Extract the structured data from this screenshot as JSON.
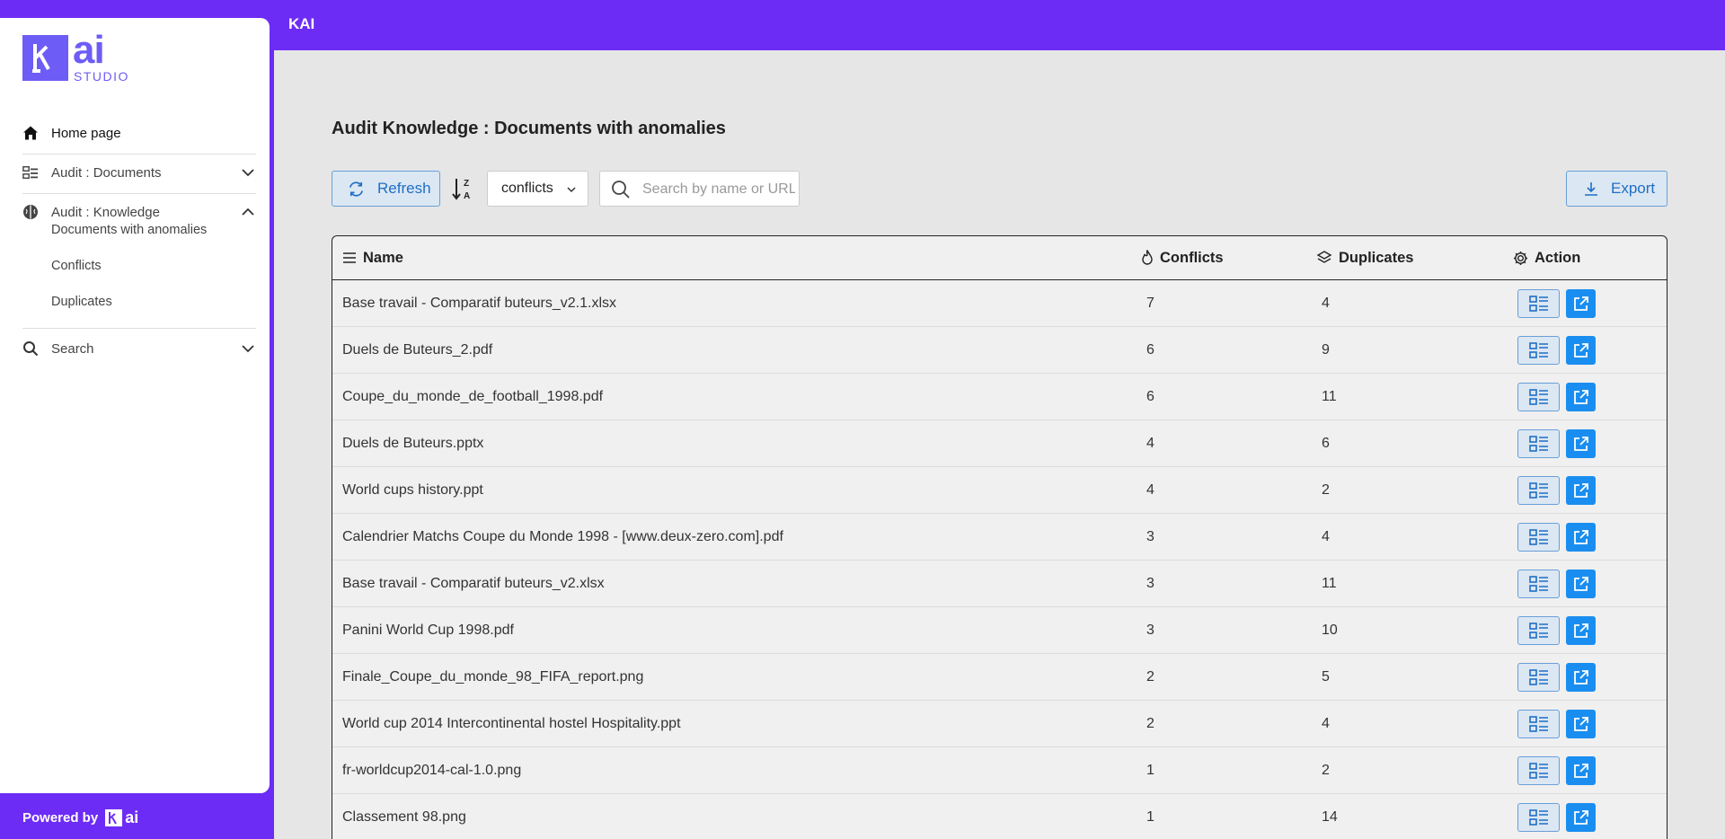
{
  "header": {
    "title": "KAI"
  },
  "logo": {
    "brand": "ai",
    "sub": "STUDIO"
  },
  "sidebar": {
    "items": [
      {
        "label": "Home page"
      },
      {
        "label": "Audit : Documents"
      },
      {
        "label": "Audit : Knowledge"
      },
      {
        "label": "Search"
      }
    ],
    "knowledge_sub": [
      {
        "label": "Documents with anomalies"
      },
      {
        "label": "Conflicts"
      },
      {
        "label": "Duplicates"
      }
    ],
    "footer": {
      "powered_by": "Powered by",
      "brand": "ai"
    }
  },
  "main": {
    "title": "Audit Knowledge : Documents with anomalies",
    "toolbar": {
      "refresh_label": "Refresh",
      "sort_select_value": "conflicts",
      "search_placeholder": "Search by name or URL",
      "export_label": "Export"
    },
    "table": {
      "columns": [
        "Name",
        "Conflicts",
        "Duplicates",
        "Action"
      ],
      "rows": [
        {
          "name": "Base travail - Comparatif buteurs_v2.1.xlsx",
          "conflicts": "7",
          "duplicates": "4"
        },
        {
          "name": "Duels de Buteurs_2.pdf",
          "conflicts": "6",
          "duplicates": "9"
        },
        {
          "name": "Coupe_du_monde_de_football_1998.pdf",
          "conflicts": "6",
          "duplicates": "11"
        },
        {
          "name": "Duels de Buteurs.pptx",
          "conflicts": "4",
          "duplicates": "6"
        },
        {
          "name": "World cups history.ppt",
          "conflicts": "4",
          "duplicates": "2"
        },
        {
          "name": "Calendrier Matchs Coupe du Monde 1998 - [www.deux-zero.com].pdf",
          "conflicts": "3",
          "duplicates": "4"
        },
        {
          "name": "Base travail - Comparatif buteurs_v2.xlsx",
          "conflicts": "3",
          "duplicates": "11"
        },
        {
          "name": "Panini World Cup 1998.pdf",
          "conflicts": "3",
          "duplicates": "10"
        },
        {
          "name": "Finale_Coupe_du_monde_98_FIFA_report.png",
          "conflicts": "2",
          "duplicates": "5"
        },
        {
          "name": "World cup 2014 Intercontinental hostel Hospitality.ppt",
          "conflicts": "2",
          "duplicates": "4"
        },
        {
          "name": "fr-worldcup2014-cal-1.0.png",
          "conflicts": "1",
          "duplicates": "2"
        },
        {
          "name": "Classement 98.png",
          "conflicts": "1",
          "duplicates": "14"
        }
      ]
    }
  },
  "colors": {
    "brand": "#6d2cf5",
    "logo": "#6d5cf6",
    "accent_blue": "#1a8ef0",
    "button_bg": "#dbe7f3"
  },
  "icons": [
    "home-icon",
    "documents-tree-icon",
    "brain-icon",
    "search-icon",
    "chevron-down-icon",
    "chevron-up-icon",
    "refresh-icon",
    "sort-alpha-desc-icon",
    "download-icon",
    "list-lines-icon",
    "flame-icon",
    "layers-icon",
    "gear-icon",
    "detail-list-icon",
    "external-link-icon"
  ]
}
